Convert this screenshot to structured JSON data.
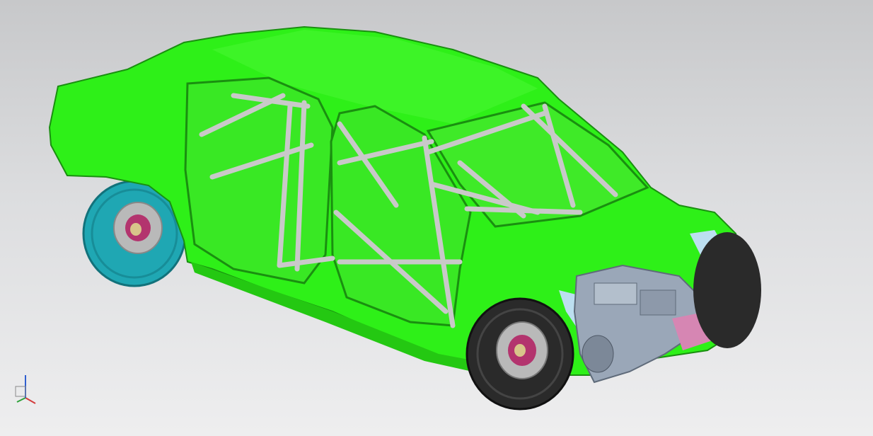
{
  "viewport": {
    "background_top": "#c7c8ca",
    "background_bottom": "#eeeeef"
  },
  "model": {
    "body_color": "#2ef018",
    "body_edge_color": "#1a8f10",
    "rollcage_color": "#c9c9c9",
    "tire_rear_color": "#1fa7b3",
    "tire_front_color": "#2a2a2a",
    "brake_disc_color": "#b9b9b9",
    "hub_color": "#b3346e",
    "engine_color": "#9aa7b8",
    "wheel_arch_liner_color": "#bcdff0"
  },
  "triad": {
    "icon": "coordinate-triad-icon",
    "x_color": "#d33c3c",
    "y_color": "#2fa23a",
    "z_color": "#2f5fd0"
  }
}
